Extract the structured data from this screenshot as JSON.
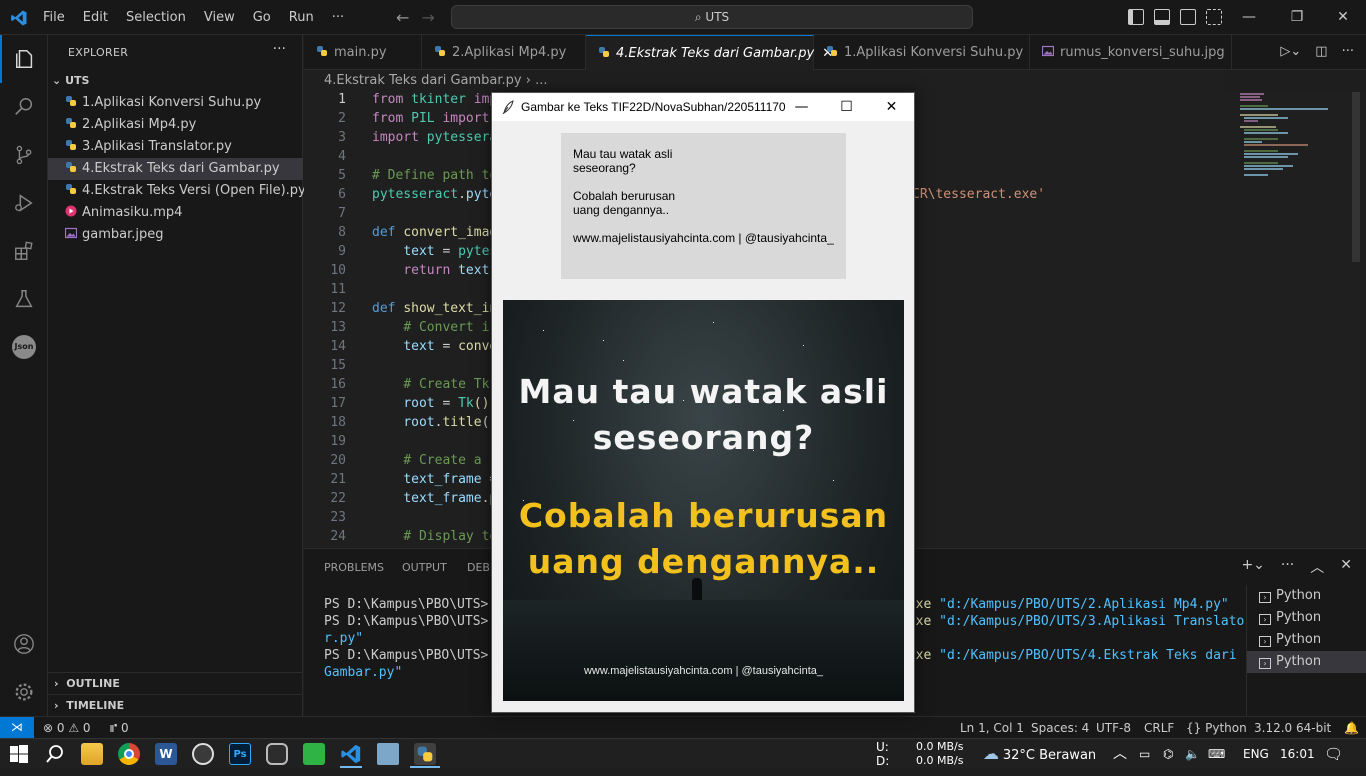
{
  "titlebar": {
    "menu": [
      "File",
      "Edit",
      "Selection",
      "View",
      "Go",
      "Run",
      "···"
    ],
    "search_text": "UTS"
  },
  "sidebar": {
    "header": "EXPLORER",
    "root": "UTS",
    "files": [
      {
        "name": "1.Aplikasi Konversi Suhu.py",
        "icon": "python-icon"
      },
      {
        "name": "2.Aplikasi Mp4.py",
        "icon": "python-icon"
      },
      {
        "name": "3.Aplikasi Translator.py",
        "icon": "python-icon"
      },
      {
        "name": "4.Ekstrak Teks dari Gambar.py",
        "icon": "python-icon"
      },
      {
        "name": "4.Ekstrak Teks Versi (Open File).py",
        "icon": "python-icon"
      },
      {
        "name": "Animasiku.mp4",
        "icon": "video-icon"
      },
      {
        "name": "gambar.jpeg",
        "icon": "image-icon"
      }
    ],
    "outline": "OUTLINE",
    "timeline": "TIMELINE"
  },
  "tabs": [
    {
      "label": "main.py"
    },
    {
      "label": "2.Aplikasi Mp4.py"
    },
    {
      "label": "4.Ekstrak Teks dari Gambar.py"
    },
    {
      "label": "1.Aplikasi Konversi Suhu.py"
    },
    {
      "label": "rumus_konversi_suhu.jpg"
    }
  ],
  "breadcrumb": "4.Ekstrak Teks dari Gambar.py › ...",
  "editor": {
    "line_numbers": [
      "1",
      "2",
      "3",
      "4",
      "5",
      "6",
      "7",
      "8",
      "9",
      "10",
      "11",
      "12",
      "13",
      "14",
      "15",
      "16",
      "17",
      "18",
      "19",
      "20",
      "21",
      "22",
      "23",
      "24"
    ],
    "path_tail": "CR\\tesseract.exe'"
  },
  "panel": {
    "tabs": [
      "PROBLEMS",
      "OUTPUT",
      "DEBU"
    ],
    "lines": [
      {
        "prompt": "PS D:\\Kampus\\PBO\\UTS> &",
        "exe": ".exe",
        "arg": "\"d:/Kampus/PBO/UTS/2.Aplikasi Mp4.py\""
      },
      {
        "prompt": "PS D:\\Kampus\\PBO\\UTS> &",
        "exe": ".exe",
        "arg": "\"d:/Kampus/PBO/UTS/3.Aplikasi Translato"
      },
      {
        "prompt": "",
        "exe": "",
        "arg": "r.py\""
      },
      {
        "prompt": "PS D:\\Kampus\\PBO\\UTS> &",
        "exe": ".exe",
        "arg": "\"d:/Kampus/PBO/UTS/4.Ekstrak Teks dari"
      },
      {
        "prompt": "",
        "exe": "",
        "arg": "Gambar.py\""
      }
    ],
    "terminals": [
      "Python",
      "Python",
      "Python",
      "Python"
    ]
  },
  "statusbar": {
    "errors": "⊗ 0 ⚠ 0",
    "ports": "⑈ 0",
    "position": "Ln 1, Col 1",
    "spaces": "Spaces: 4",
    "encoding": "UTF-8",
    "eol": "CRLF",
    "language": "Python",
    "interpreter": "3.12.0 64-bit"
  },
  "tkwindow": {
    "title": "Gambar ke Teks TIF22D/NovaSubhan/220511170",
    "ocr_lines": [
      "Mau tau watak asli",
      "seseorang?",
      "",
      "Cobalah berurusan",
      "uang dengannya..",
      "",
      "www.majelistausiyahcinta.com | @tausiyahcinta_"
    ],
    "image": {
      "line1": "Mau tau watak asli",
      "line2": "seseorang?",
      "line3": "Cobalah berurusan",
      "line4": "uang dengannya..",
      "footer": "www.majelistausiyahcinta.com | @tausiyahcinta_"
    }
  },
  "taskbar": {
    "net_up_label": "U:",
    "net_up": "0.0 MB/s",
    "net_down_label": "D:",
    "net_down": "0.0 MB/s",
    "weather": "32°C Berawan",
    "lang": "ENG",
    "time": "16:01"
  },
  "colors": {
    "accent": "#0078d4",
    "keyword": "#c586c0",
    "function": "#dcdcaa",
    "variable": "#9cdcfe",
    "comment": "#6a9955",
    "quote_yellow": "#f3c11e"
  }
}
